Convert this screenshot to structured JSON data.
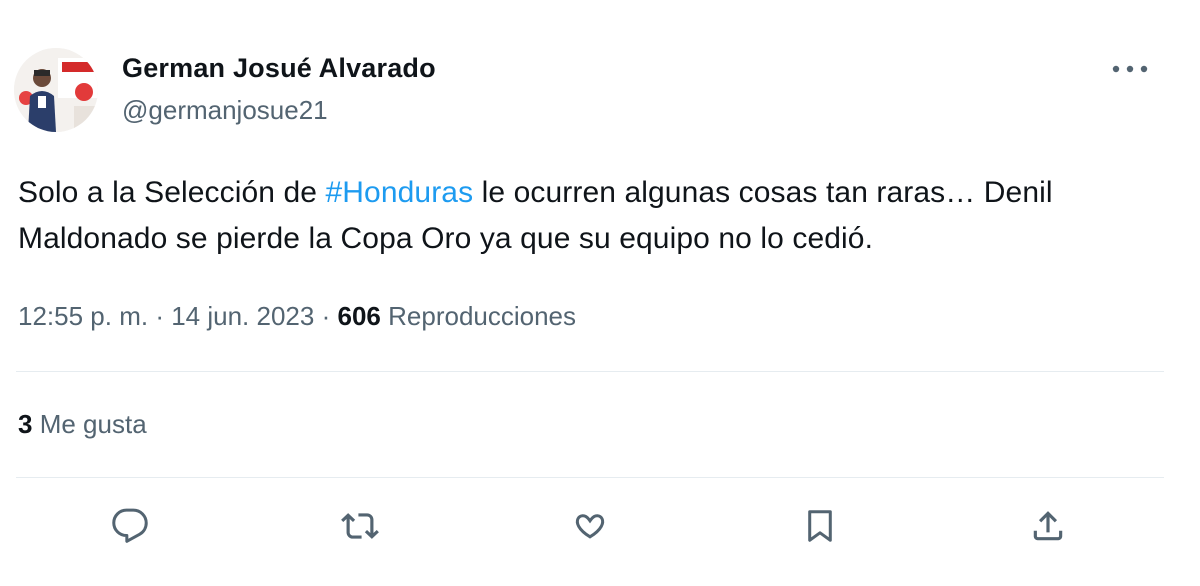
{
  "author": {
    "display_name": "German Josué Alvarado",
    "handle": "@germanjosue21"
  },
  "tweet": {
    "text_before": "Solo a la Selección de ",
    "hashtag": "#Honduras",
    "text_after": " le ocurren algunas cosas tan raras… Denil Maldonado se pierde la Copa Oro ya que su equipo no lo cedió."
  },
  "meta": {
    "time": "12:55 p. m.",
    "date": "14 jun. 2023",
    "separator": "·",
    "views_count": "606",
    "views_label": "Reproducciones"
  },
  "likes": {
    "count": "3",
    "label": "Me gusta"
  },
  "actions": {
    "reply": "reply-icon",
    "retweet": "retweet-icon",
    "like": "heart-icon",
    "bookmark": "bookmark-icon",
    "share": "share-icon"
  },
  "colors": {
    "link": "#1d9bf0",
    "secondary_text": "#536471",
    "primary_text": "#0f1419"
  }
}
